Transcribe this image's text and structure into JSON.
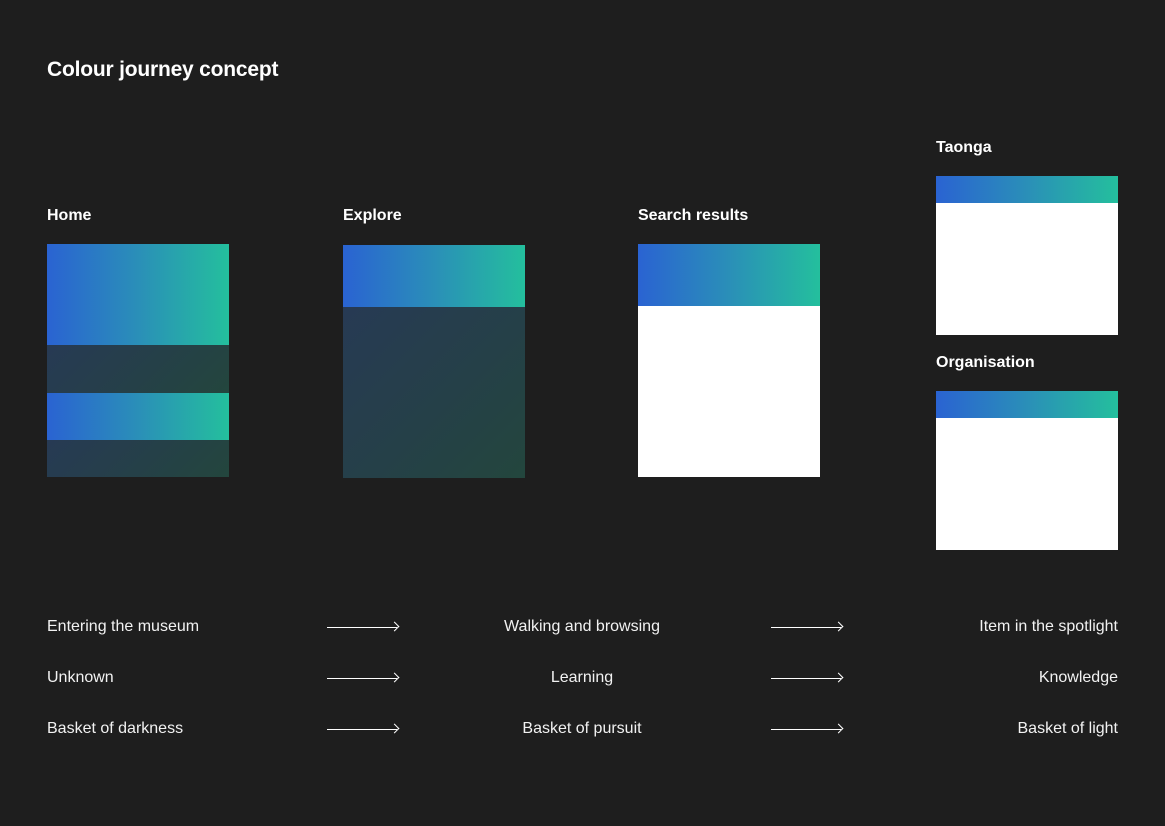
{
  "title": "Colour journey concept",
  "panels": {
    "home": "Home",
    "explore": "Explore",
    "search": "Search results",
    "taonga": "Taonga",
    "organisation": "Organisation"
  },
  "journey": [
    {
      "from": "Entering the museum",
      "via": "Walking and browsing",
      "to": "Item in the spotlight"
    },
    {
      "from": "Unknown",
      "via": "Learning",
      "to": "Knowledge"
    },
    {
      "from": "Basket of darkness",
      "via": "Basket of pursuit",
      "to": "Basket of light"
    }
  ],
  "colors": {
    "background": "#1e1e1e",
    "gradient_start": "#2a63d2",
    "gradient_end": "#24bf9d",
    "dark_start": "#273a54",
    "dark_end": "#23463d"
  }
}
